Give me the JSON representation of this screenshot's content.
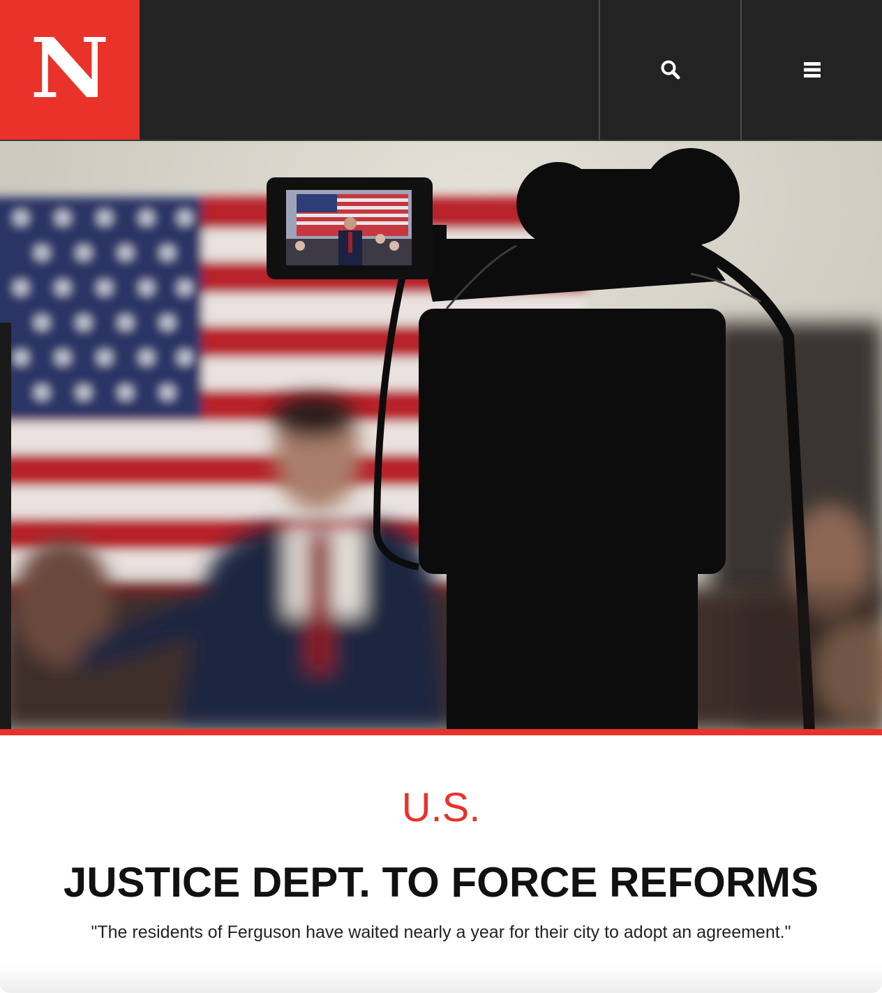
{
  "header": {
    "logo_text": "N",
    "search_icon": "search-icon",
    "menu_icon": "hamburger-menu-icon",
    "colors": {
      "brand_red": "#e8322a",
      "bar": "#232323"
    }
  },
  "hero": {
    "image_subject": "news-photo"
  },
  "article": {
    "category": "U.S.",
    "headline": "JUSTICE DEPT. TO FORCE REFORMS",
    "dek": "\"The residents of Ferguson have waited nearly a year for their city to adopt an agreement.\""
  }
}
